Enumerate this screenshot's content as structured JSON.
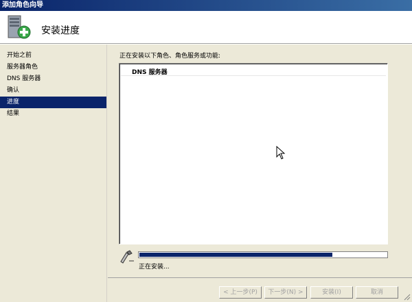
{
  "window": {
    "title": "添加角色向导"
  },
  "header": {
    "title": "安装进度",
    "icon": "server-add-icon"
  },
  "sidebar": {
    "items": [
      {
        "label": "开始之前",
        "active": false
      },
      {
        "label": "服务器角色",
        "active": false
      },
      {
        "label": "DNS 服务器",
        "active": false
      },
      {
        "label": "确认",
        "active": false
      },
      {
        "label": "进度",
        "active": true
      },
      {
        "label": "结果",
        "active": false
      }
    ]
  },
  "main": {
    "caption": "正在安装以下角色、角色服务或功能:",
    "list": [
      "DNS 服务器"
    ],
    "progress": {
      "fraction": 0.78,
      "status": "正在安装..."
    }
  },
  "footer": {
    "back_label": "< 上一步(P)",
    "next_label": "下一步(N) >",
    "install_label": "安装(I)",
    "cancel_label": "取消"
  },
  "colors": {
    "accent": "#0a246a",
    "panel": "#ece9d8"
  }
}
